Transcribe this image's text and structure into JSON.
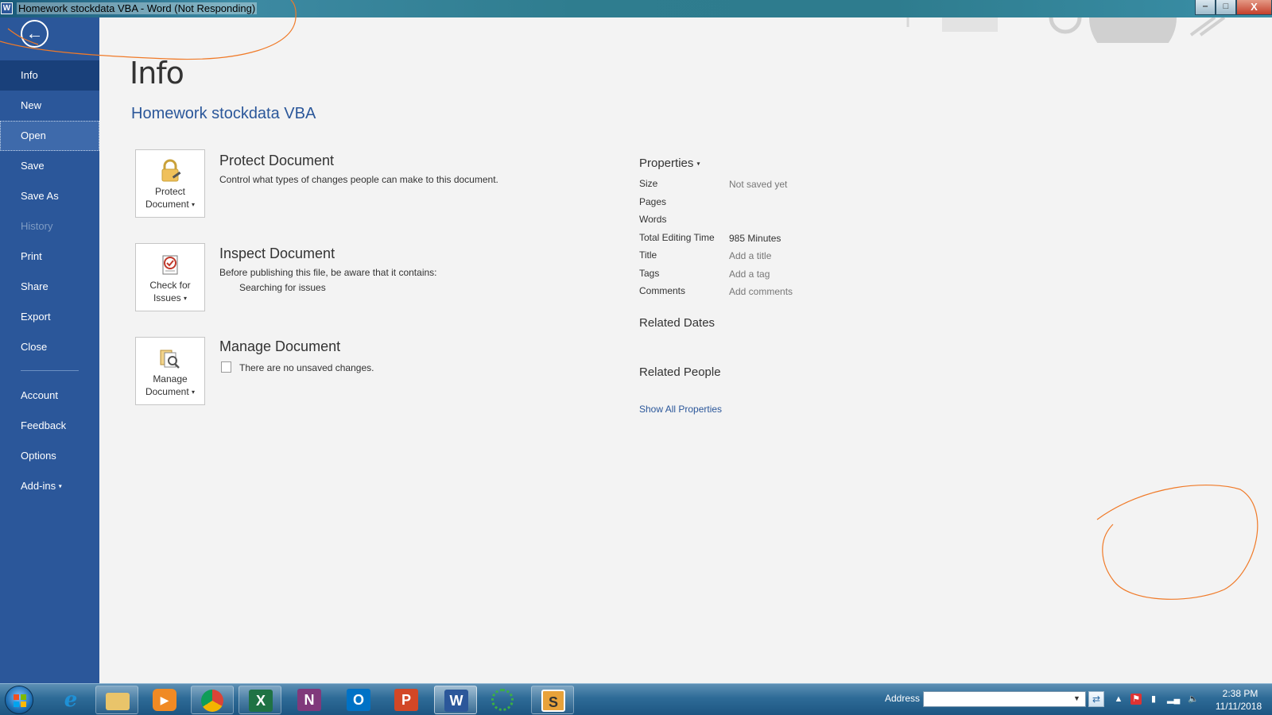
{
  "window": {
    "title": "Homework stockdata VBA - Word (Not Responding)",
    "app_logo_letter": "W",
    "controls": {
      "minimize": "‒",
      "maximize": "□",
      "close": "X"
    }
  },
  "sidebar": {
    "back_icon": "arrow-left-icon",
    "items": [
      {
        "label": "Info",
        "state": "selected"
      },
      {
        "label": "New",
        "state": "normal"
      },
      {
        "label": "Open",
        "state": "hover"
      },
      {
        "label": "Save",
        "state": "normal"
      },
      {
        "label": "Save As",
        "state": "normal"
      },
      {
        "label": "History",
        "state": "disabled"
      },
      {
        "label": "Print",
        "state": "normal"
      },
      {
        "label": "Share",
        "state": "normal"
      },
      {
        "label": "Export",
        "state": "normal"
      },
      {
        "label": "Close",
        "state": "normal"
      }
    ],
    "bottom_items": [
      {
        "label": "Account"
      },
      {
        "label": "Feedback"
      },
      {
        "label": "Options"
      },
      {
        "label": "Add-ins"
      }
    ],
    "accent": "#2b579a"
  },
  "main": {
    "page_title": "Info",
    "doc_title": "Homework stockdata VBA",
    "sections": [
      {
        "button_line1": "Protect",
        "button_line2": "Document",
        "icon": "lock-icon",
        "title": "Protect Document",
        "desc": "Control what types of changes people can make to this document."
      },
      {
        "button_line1": "Check for",
        "button_line2": "Issues",
        "icon": "checklist-icon",
        "title": "Inspect Document",
        "desc": "Before publishing this file, be aware that it contains:",
        "sub": "Searching for issues"
      },
      {
        "button_line1": "Manage",
        "button_line2": "Document",
        "icon": "manage-document-icon",
        "title": "Manage Document",
        "desc": "There are no unsaved changes."
      }
    ]
  },
  "properties": {
    "heading": "Properties",
    "rows": [
      {
        "label": "Size",
        "value": "Not saved yet"
      },
      {
        "label": "Pages",
        "value": ""
      },
      {
        "label": "Words",
        "value": ""
      },
      {
        "label": "Total Editing Time",
        "value": "985 Minutes"
      },
      {
        "label": "Title",
        "value": "Add a title"
      },
      {
        "label": "Tags",
        "value": "Add a tag"
      },
      {
        "label": "Comments",
        "value": "Add comments"
      }
    ],
    "related_dates": "Related Dates",
    "related_people": "Related People",
    "show_all": "Show All Properties"
  },
  "taskbar": {
    "apps": [
      {
        "name": "internet-explorer-icon",
        "letter": "e",
        "color": "#1e90d6"
      },
      {
        "name": "file-explorer-icon",
        "letter": "",
        "color": "#e9c46a"
      },
      {
        "name": "media-player-icon",
        "letter": "▶",
        "color": "#f08a24"
      },
      {
        "name": "chrome-icon",
        "letter": "",
        "color": "#db4437"
      },
      {
        "name": "excel-icon",
        "letter": "X",
        "color": "#1f7244"
      },
      {
        "name": "onenote-icon",
        "letter": "N",
        "color": "#80397b"
      },
      {
        "name": "outlook-icon",
        "letter": "O",
        "color": "#0072c6"
      },
      {
        "name": "powerpoint-icon",
        "letter": "P",
        "color": "#d24726"
      },
      {
        "name": "word-icon",
        "letter": "W",
        "color": "#2b579a"
      },
      {
        "name": "loading-ring-icon",
        "letter": "",
        "color": "#3cb043"
      },
      {
        "name": "slack-icon",
        "letter": "S",
        "color": "#e8a23a"
      }
    ],
    "address_label": "Address",
    "address_value": "",
    "time": "2:38 PM",
    "date": "11/11/2018"
  },
  "annotation_color": "#f07a28"
}
